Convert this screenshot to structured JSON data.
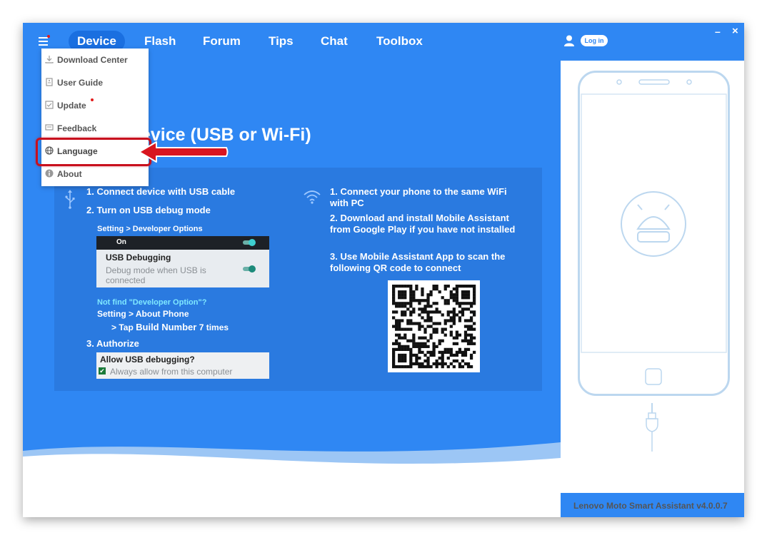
{
  "nav": {
    "items": [
      {
        "label": "Device",
        "active": true
      },
      {
        "label": "Flash",
        "active": false
      },
      {
        "label": "Forum",
        "active": false
      },
      {
        "label": "Tips",
        "active": false
      },
      {
        "label": "Chat",
        "active": false
      },
      {
        "label": "Toolbox",
        "active": false
      }
    ],
    "login_label": "Log in",
    "minimize_glyph": "–",
    "close_glyph": "×"
  },
  "menu": {
    "items": [
      {
        "label": "Download Center",
        "icon": "download-icon"
      },
      {
        "label": "User Guide",
        "icon": "guide-icon"
      },
      {
        "label": "Update",
        "icon": "update-icon",
        "badge": true
      },
      {
        "label": "Feedback",
        "icon": "feedback-icon"
      },
      {
        "label": "Language",
        "icon": "globe-icon",
        "highlighted": true
      },
      {
        "label": "About",
        "icon": "info-icon"
      }
    ]
  },
  "main": {
    "title": "evice (USB or Wi-Fi)",
    "usb": {
      "step1": "1. Connect device with USB cable",
      "step2": "2. Turn on USB debug mode",
      "path": "Setting > Developer Options",
      "card": {
        "on_label": "On",
        "title": "USB Debugging",
        "desc": "Debug mode when USB is connected"
      },
      "not_find": "Not find \"Developer Option\"?",
      "about_path": "Setting > About Phone",
      "tap_prefix": "> Tap ",
      "tap_target": "Build Number",
      "tap_suffix": " 7 times",
      "step3": "3. Authorize",
      "auth": {
        "title": "Allow USB debugging?",
        "desc": "Always allow from this computer",
        "check_glyph": "✔"
      }
    },
    "wifi": {
      "step1": "1. Connect your phone to the same WiFi with PC",
      "step2": "2. Download and install Mobile Assistant from Google Play if you have not installed",
      "step3": "3. Use Mobile Assistant App to scan the following QR code to connect"
    }
  },
  "footer": {
    "version": "Lenovo Moto Smart Assistant v4.0.0.7"
  },
  "colors": {
    "brand_blue": "#2f87f3",
    "panel_blue": "#2a7ae0",
    "highlight_red": "#c8101d"
  }
}
